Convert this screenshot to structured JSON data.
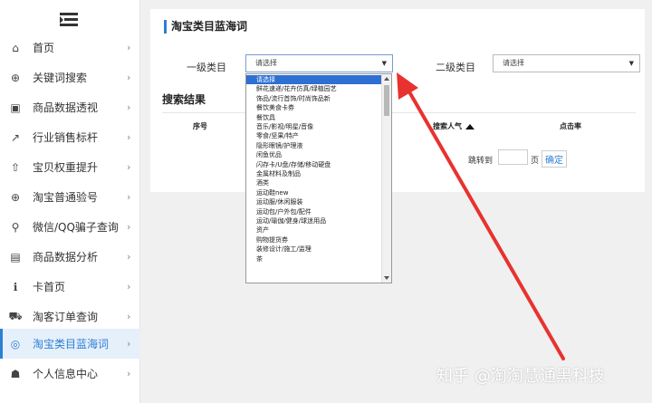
{
  "sidebar": {
    "items": [
      {
        "label": "首页",
        "icon": "home-icon",
        "glyph": "⌂"
      },
      {
        "label": "关键词搜索",
        "icon": "search-plus-icon",
        "glyph": "⊕"
      },
      {
        "label": "商品数据透视",
        "icon": "camera-icon",
        "glyph": "▣"
      },
      {
        "label": "行业销售标杆",
        "icon": "line-chart-icon",
        "glyph": "↗"
      },
      {
        "label": "宝贝权重提升",
        "icon": "upload-icon",
        "glyph": "⇧"
      },
      {
        "label": "淘宝普通验号",
        "icon": "search-plus-icon",
        "glyph": "⊕"
      },
      {
        "label": "微信/QQ骗子查询",
        "icon": "search-icon",
        "glyph": "⚲"
      },
      {
        "label": "商品数据分析",
        "icon": "file-icon",
        "glyph": "▤"
      },
      {
        "label": "卡首页",
        "icon": "info-icon",
        "glyph": "ℹ"
      },
      {
        "label": "淘客订单查询",
        "icon": "cart-icon",
        "glyph": "⛟"
      },
      {
        "label": "淘宝类目蓝海词",
        "icon": "globe-icon",
        "glyph": "◎"
      },
      {
        "label": "个人信息中心",
        "icon": "user-icon",
        "glyph": "☗"
      }
    ],
    "active_index": 10,
    "chevron": "›"
  },
  "main": {
    "title": "淘宝类目蓝海词",
    "level1_label": "一级类目",
    "level1_value": "请选择",
    "level2_label": "二级类目",
    "level2_value": "请选择",
    "results_title": "搜索结果",
    "columns": [
      "序号",
      "搜索人气",
      "点击率"
    ],
    "jump_label": "跳转到",
    "page_unit": "页",
    "confirm_label": "确定"
  },
  "dropdown": {
    "options": [
      "请选择",
      "鲜花速递/花卉仿真/绿植园艺",
      "饰品/流行首饰/时尚饰品新",
      "餐饮美食卡券",
      "餐饮具",
      "音乐/影视/明星/音像",
      "零食/坚果/特产",
      "隐形眼镜/护理液",
      "闲鱼优品",
      "闪存卡/U盘/存储/移动硬盘",
      "金属材料及制品",
      "酒类",
      "运动鞋new",
      "运动服/休闲服装",
      "运动包/户外包/配件",
      "运动/瑜伽/健身/球迷用品",
      "资产",
      "购物提货券",
      "装修设计/施工/监理",
      "茶"
    ],
    "selected_index": 0
  },
  "watermark": "知乎 @淘淘慧通黑科技",
  "colors": {
    "accent": "#2d7fd3",
    "arrow": "#e8322f",
    "active_bg": "#e6f0fb"
  }
}
